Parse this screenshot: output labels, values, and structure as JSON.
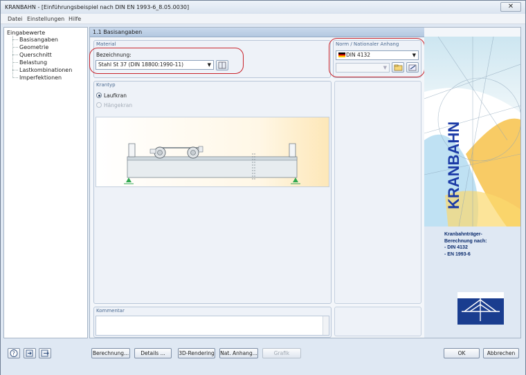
{
  "window": {
    "title": "KRANBAHN - [Einführungsbeispiel nach DIN EN 1993-6_8.05.0030]",
    "close_glyph": "✕"
  },
  "menu": {
    "items": [
      "Datei",
      "Einstellungen",
      "Hilfe"
    ]
  },
  "nav": {
    "root": "Eingabewerte",
    "items": [
      "Basisangaben",
      "Geometrie",
      "Querschnitt",
      "Belastung",
      "Lastkombinationen",
      "Imperfektionen"
    ],
    "selected_index": 0
  },
  "panel": {
    "title": "1.1 Basisangaben"
  },
  "material": {
    "group_label": "Material",
    "field_label": "Bezeichnung:",
    "value": "Stahl St 37 (DIN 18800:1990-11)"
  },
  "norm": {
    "group_label": "Norm / Nationaler Anhang",
    "value": "DIN 4132",
    "annex_value": "",
    "flag": "de-flag-icon"
  },
  "krantyp": {
    "group_label": "Krantyp",
    "options": [
      {
        "label": "Laufkran",
        "selected": true,
        "enabled": true
      },
      {
        "label": "Hängekran",
        "selected": false,
        "enabled": false
      }
    ]
  },
  "kommentar": {
    "group_label": "Kommentar",
    "value": ""
  },
  "banner": {
    "word": "KRANBAHN",
    "caption": [
      "Kranbahnträger-",
      "Berechnung nach:",
      "- DIN 4132",
      "- EN 1993-6"
    ]
  },
  "buttons": {
    "berechnung": "Berechnung...",
    "details": "Details ...",
    "rendering": "3D-Rendering",
    "nat_anhang": "Nat. Anhang...",
    "grafik": "Grafik",
    "ok": "OK",
    "abbrechen": "Abbrechen"
  },
  "colors": {
    "accent_red": "#c8222a",
    "banner_blue": "#0a2a6c",
    "panel_header": "#b4c8e0"
  }
}
